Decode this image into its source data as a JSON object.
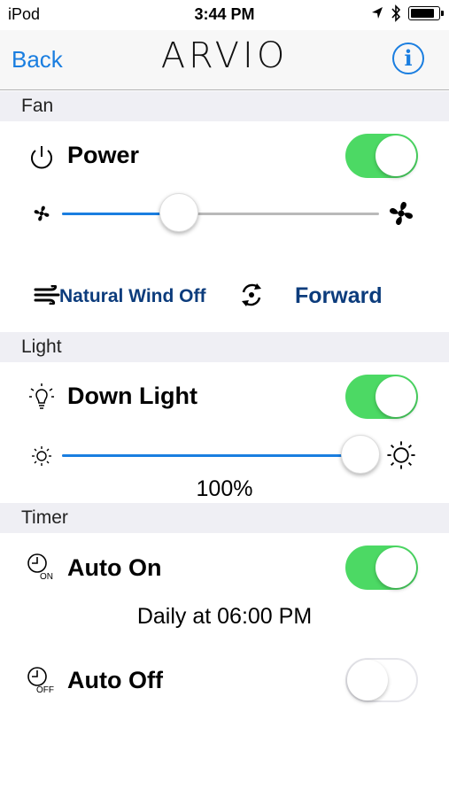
{
  "status": {
    "carrier": "iPod",
    "time": "3:44 PM",
    "battery_level": 0.85
  },
  "nav": {
    "back_label": "Back",
    "title": "ARVIO",
    "info_label": "i"
  },
  "fan": {
    "section_title": "Fan",
    "power_label": "Power",
    "power_on": true,
    "speed_level": 0.37,
    "natural_wind_label": "Natural Wind Off",
    "direction_label": "Forward",
    "icons": [
      "power-icon",
      "fan-small-icon",
      "fan-large-icon",
      "natural-wind-icon",
      "direction-icon"
    ]
  },
  "light": {
    "section_title": "Light",
    "downlight_label": "Down Light",
    "downlight_on": true,
    "brightness_level": 0.94,
    "brightness_text": "100%",
    "icons": [
      "bulb-icon",
      "sun-small-icon",
      "sun-large-icon"
    ]
  },
  "timer": {
    "section_title": "Timer",
    "auto_on_label": "Auto On",
    "auto_on_enabled": true,
    "auto_on_schedule": "Daily at 06:00 PM",
    "auto_on_badge": "ON",
    "auto_off_label": "Auto Off",
    "auto_off_enabled": false,
    "auto_off_badge": "OFF",
    "icons": [
      "clock-on-icon",
      "clock-off-icon"
    ]
  },
  "colors": {
    "accent": "#1a7ee0",
    "switch_on": "#4cd964",
    "mode_text": "#0c3c7c",
    "section_bg": "#efeff4"
  }
}
